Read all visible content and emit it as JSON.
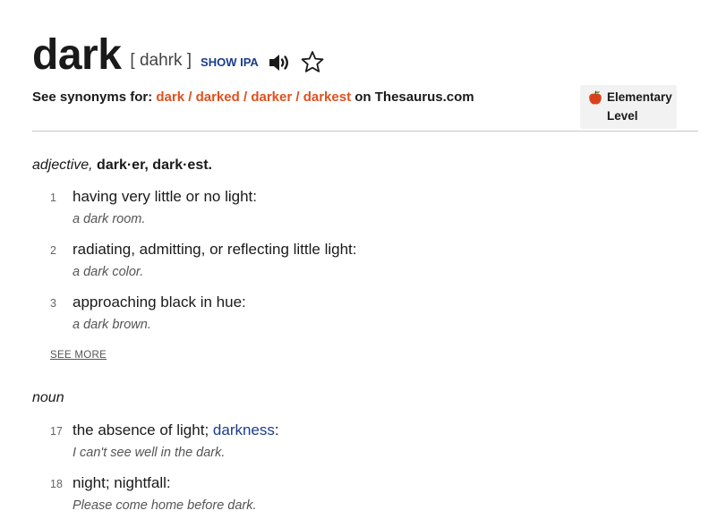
{
  "entry": {
    "headword": "dark",
    "pronunciation": "[ dahrk ]",
    "show_ipa": "SHOW IPA",
    "audio_icon": "speaker-icon",
    "favorite_icon": "star-icon"
  },
  "synonyms": {
    "prefix": "See synonyms for:",
    "forms": [
      "dark",
      "darked",
      "darker",
      "darkest"
    ],
    "separator": " / ",
    "suffix": "on Thesaurus.com"
  },
  "level": {
    "icon": "apple-icon",
    "line1": "Elementary",
    "line2": "Level"
  },
  "adjective": {
    "pos": "adjective,",
    "forms": "dark·er, dark·est.",
    "definitions": [
      {
        "num": "1",
        "text": "having very little or no light:",
        "example": "a dark room."
      },
      {
        "num": "2",
        "text": "radiating, admitting, or reflecting little light:",
        "example": "a dark color."
      },
      {
        "num": "3",
        "text": "approaching black in hue:",
        "example": "a dark brown."
      }
    ],
    "see_more": "SEE MORE"
  },
  "noun": {
    "pos": "noun",
    "definitions": [
      {
        "num": "17",
        "text_before": "the absence of light;",
        "link": "darkness",
        "text_after": ":",
        "example": "I can't see well in the dark."
      },
      {
        "num": "18",
        "text": "night; nightfall:",
        "example": "Please come home before dark."
      }
    ]
  },
  "colors": {
    "accent_orange": "#e0501e",
    "link_blue": "#1a3c8c",
    "text": "#1a1a1a"
  }
}
